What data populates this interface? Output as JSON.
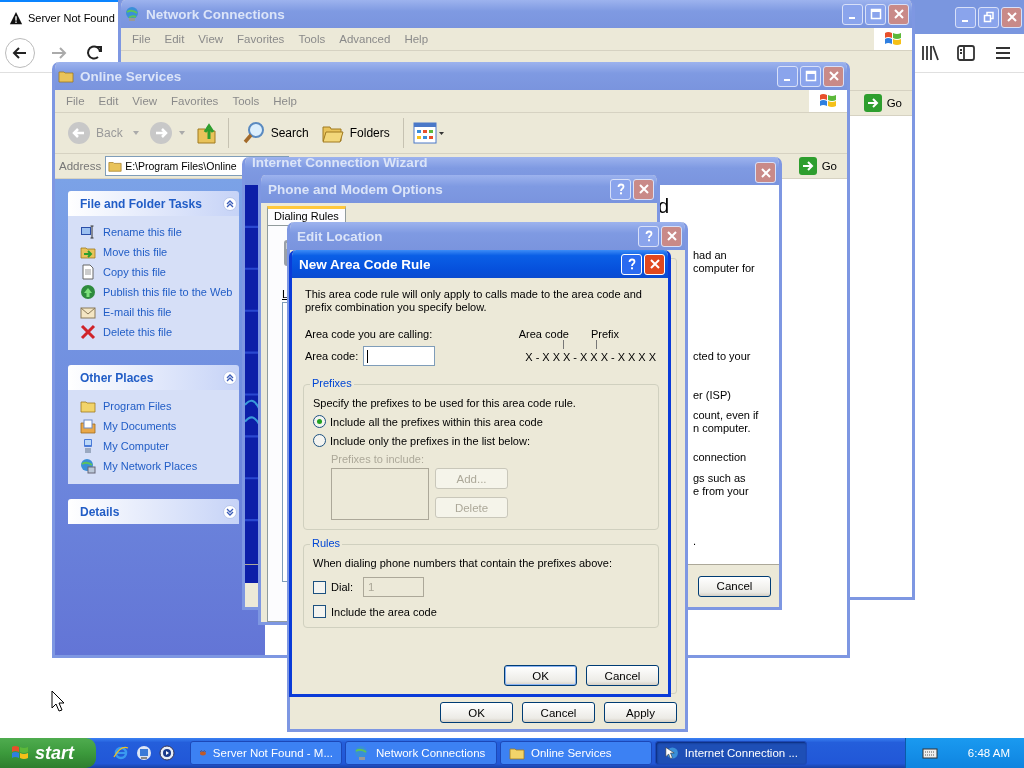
{
  "browser": {
    "tab_title": "Server Not Found"
  },
  "network_connections": {
    "title": "Network Connections",
    "menu": [
      "File",
      "Edit",
      "View",
      "Favorites",
      "Tools",
      "Advanced",
      "Help"
    ],
    "go": "Go"
  },
  "online_services": {
    "title": "Online Services",
    "menu": [
      "File",
      "Edit",
      "View",
      "Favorites",
      "Tools",
      "Help"
    ],
    "toolbar": {
      "back": "Back",
      "search": "Search",
      "folders": "Folders"
    },
    "address": {
      "label": "Address",
      "value": "E:\\Program Files\\Online"
    },
    "go": "Go",
    "panels": [
      {
        "title": "File and Folder Tasks",
        "expanded": true,
        "items": [
          {
            "label": "Rename this file",
            "kind": "rename"
          },
          {
            "label": "Move this file",
            "kind": "move"
          },
          {
            "label": "Copy this file",
            "kind": "copy"
          },
          {
            "label": "Publish this file to the Web",
            "kind": "publish"
          },
          {
            "label": "E-mail this file",
            "kind": "email"
          },
          {
            "label": "Delete this file",
            "kind": "delete"
          }
        ]
      },
      {
        "title": "Other Places",
        "expanded": true,
        "items": [
          {
            "label": "Program Files",
            "kind": "folder"
          },
          {
            "label": "My Documents",
            "kind": "documents"
          },
          {
            "label": "My Computer",
            "kind": "computer"
          },
          {
            "label": "My Network Places",
            "kind": "network"
          }
        ]
      },
      {
        "title": "Details",
        "expanded": false
      }
    ]
  },
  "wizard": {
    "title": "Internet Connection Wizard",
    "heading": "d",
    "paragraphs": [
      [
        "had an",
        "computer for"
      ],
      [
        "cted to your"
      ],
      [
        "er (ISP)"
      ],
      [
        "count, even if",
        "n computer."
      ],
      [
        "connection"
      ],
      [
        "gs such as",
        "e from your"
      ],
      [
        "."
      ]
    ],
    "cancel": "Cancel"
  },
  "phone_modem": {
    "title": "Phone and Modem Options",
    "tabs": [
      {
        "label": "Dialing Rules",
        "selected": true
      }
    ],
    "list_label": "L"
  },
  "edit_location": {
    "title": "Edit Location",
    "buttons": [
      "OK",
      "Cancel",
      "Apply"
    ]
  },
  "area_code_rule": {
    "title": "New Area Code Rule",
    "intro": "This area code rule will only apply to calls made to the area code and prefix combination you specify below.",
    "calling_label": "Area code you are calling:",
    "area_code_label": "Area code:",
    "diagram": {
      "area_code": "Area code",
      "prefix": "Prefix",
      "pattern": "X-XXX-XXX-XXXX"
    },
    "prefixes": {
      "title": "Prefixes",
      "instruction": "Specify the prefixes to be used for this area code rule.",
      "options": [
        {
          "label": "Include all the prefixes within this area code",
          "selected": true
        },
        {
          "label": "Include only the prefixes in the list below:",
          "selected": false
        }
      ],
      "list_label": "Prefixes to include:",
      "add": "Add...",
      "delete": "Delete",
      "disabled": true
    },
    "rules": {
      "title": "Rules",
      "instruction": "When dialing phone numbers that contain the prefixes above:",
      "dial": {
        "label": "Dial:",
        "checked": false,
        "value": "1",
        "disabled": true
      },
      "include_area_code": {
        "label": "Include the area code",
        "checked": false
      }
    },
    "buttons": [
      "OK",
      "Cancel"
    ]
  },
  "taskbar": {
    "start": "start",
    "tasks": [
      {
        "label": "Server Not Found - M...",
        "kind": "browser",
        "selected": false
      },
      {
        "label": "Network Connections",
        "kind": "network",
        "selected": false
      },
      {
        "label": "Online Services",
        "kind": "folder",
        "selected": false
      },
      {
        "label": "Internet Connection ...",
        "kind": "wizard",
        "selected": true
      }
    ],
    "clock": "6:48 AM"
  }
}
